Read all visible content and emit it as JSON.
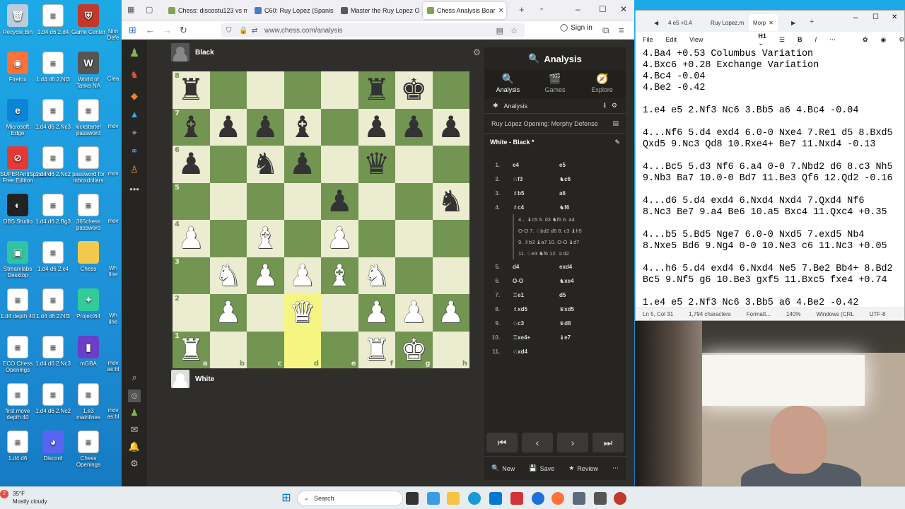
{
  "desktop": {
    "icons": [
      {
        "label": "Recycle Bin",
        "glyph": "🗑",
        "color": "#bcd"
      },
      {
        "label": "1.d4 d6 2.d4",
        "glyph": "≡",
        "color": "#fff"
      },
      {
        "label": "Game Center",
        "glyph": "⛨",
        "color": "#c0392b"
      },
      {
        "label": "Firefox",
        "glyph": "◉",
        "color": "#ff7139"
      },
      {
        "label": "1.d4 d6 2.Nf3",
        "glyph": "≡",
        "color": "#fff"
      },
      {
        "label": "World of Tanks NA",
        "glyph": "W",
        "color": "#555"
      },
      {
        "label": "Microsoft Edge",
        "glyph": "e",
        "color": "#0b84d8"
      },
      {
        "label": "1.d4 d6 2.Nc3",
        "glyph": "≡",
        "color": "#fff"
      },
      {
        "label": "kickstarter password",
        "glyph": "≡",
        "color": "#fff"
      },
      {
        "label": "SUPERAntiSpyware Free Edition",
        "glyph": "⊘",
        "color": "#e53935"
      },
      {
        "label": "1.d4 d6 2.Nc2",
        "glyph": "≡",
        "color": "#fff"
      },
      {
        "label": "password for inboxdollars",
        "glyph": "≡",
        "color": "#fff"
      },
      {
        "label": "OBS Studio",
        "glyph": "◐",
        "color": "#222"
      },
      {
        "label": "1.d4 d6 2.Bg3",
        "glyph": "≡",
        "color": "#fff"
      },
      {
        "label": "365chess password",
        "glyph": "≡",
        "color": "#fff"
      },
      {
        "label": "Streamlabs Desktop",
        "glyph": "▣",
        "color": "#31c3a2"
      },
      {
        "label": "1.d4 d6 2.c4",
        "glyph": "≡",
        "color": "#fff"
      },
      {
        "label": "Chess",
        "glyph": "",
        "color": "#f2c94c"
      },
      {
        "label": "1.d4 depth 40",
        "glyph": "≡",
        "color": "#fff"
      },
      {
        "label": "1.d4 d6 2.Nf3",
        "glyph": "≡",
        "color": "#fff"
      },
      {
        "label": "Project64",
        "glyph": "✦",
        "color": "#3c9"
      },
      {
        "label": "ECO Chess Openings",
        "glyph": "≡",
        "color": "#fff"
      },
      {
        "label": "1.d4 d6 2.Nc3",
        "glyph": "≡",
        "color": "#fff"
      },
      {
        "label": "mGBA",
        "glyph": "▮",
        "color": "#6a3ec9"
      },
      {
        "label": "first move depth 40",
        "glyph": "≡",
        "color": "#fff"
      },
      {
        "label": "1.d4 d6 2.Nc2",
        "glyph": "≡",
        "color": "#fff"
      },
      {
        "label": "1.e3 mainlines",
        "glyph": "≡",
        "color": "#fff"
      },
      {
        "label": "1.d4 d6",
        "glyph": "≡",
        "color": "#fff"
      },
      {
        "label": "Discord",
        "glyph": "◕",
        "color": "#5865f2"
      },
      {
        "label": "Chess Openings",
        "glyph": "≡",
        "color": "#fff"
      }
    ],
    "partial_col3": [
      "Nim Defe",
      "Clea",
      "mov",
      "mov",
      "mov",
      "Wh line",
      "Wh line",
      "mov as bl",
      "mov as bl"
    ]
  },
  "browser": {
    "tabs": [
      {
        "title": "Chess: discostu123 vs m",
        "color": "#7fa650"
      },
      {
        "title": "C60: Ruy Lopez (Spanish",
        "color": "#4a7bd0"
      },
      {
        "title": "Master the Ruy Lopez O",
        "color": "#5a5a5a"
      },
      {
        "title": "Chess Analysis Boar",
        "color": "#7fa650",
        "active": true
      }
    ],
    "url": "www.chess.com/analysis",
    "sign_in": "Sign in"
  },
  "chess": {
    "top_player": "Black",
    "bottom_player": "White",
    "board": [
      [
        "bR",
        "",
        "",
        "",
        "",
        "bR",
        "bK",
        ""
      ],
      [
        "bB",
        "bP",
        "bP",
        "bB",
        "",
        "bP",
        "bP",
        "bP"
      ],
      [
        "bP",
        "",
        "bN",
        "bP",
        "",
        "bQ",
        "",
        ""
      ],
      [
        "",
        "",
        "",
        "",
        "bP",
        "",
        "",
        "bN"
      ],
      [
        "wP",
        "",
        "wB",
        "",
        "wP",
        "",
        "",
        ""
      ],
      [
        "",
        "wN",
        "wP",
        "wP",
        "wB",
        "wN",
        "",
        ""
      ],
      [
        "",
        "wP",
        "",
        "wQ",
        "",
        "wP",
        "wP",
        "wP"
      ],
      [
        "wR",
        "",
        "",
        "",
        "",
        "wR",
        "wK",
        ""
      ]
    ],
    "highlight": [
      [
        6,
        3
      ],
      [
        7,
        3
      ]
    ],
    "ranks": [
      "8",
      "7",
      "6",
      "5",
      "4",
      "3",
      "2",
      "1"
    ],
    "files": [
      "a",
      "b",
      "c",
      "d",
      "e",
      "f",
      "g",
      "h"
    ],
    "panel_title": "Analysis",
    "panel_tabs": [
      "Analysis",
      "Games",
      "Explore"
    ],
    "engine_label": "Analysis",
    "opening": "Ruy López Opening: Morphy Defense",
    "players_line": "White - Black *",
    "moves": [
      {
        "n": "1.",
        "w": "e4",
        "b": "e5"
      },
      {
        "n": "2.",
        "w": "♘f3",
        "b": "♞c6"
      },
      {
        "n": "3.",
        "w": "♗b5",
        "b": "a6"
      },
      {
        "n": "4.",
        "w": "♗c4",
        "b": "♞f6"
      }
    ],
    "variation_lines": [
      "4... ♝c5  5. d3  ♞f6  6. a4",
      "O-O  7. ♘bd2  d6  8. c3  ♝h5",
      "9. ♗b3  ♝a7  10. O-O  ♝d7",
      "11. ♘e3  ♞f6  12. ♕d2"
    ],
    "moves2": [
      {
        "n": "5.",
        "w": "d4",
        "b": "exd4"
      },
      {
        "n": "6.",
        "w": "O-O",
        "b": "♞xe4"
      },
      {
        "n": "7.",
        "w": "♖e1",
        "b": "d5"
      },
      {
        "n": "8.",
        "w": "♗xd5",
        "b": "♛xd5"
      },
      {
        "n": "9.",
        "w": "♘c3",
        "b": "♛d8"
      },
      {
        "n": "10.",
        "w": "♖xe4+",
        "b": "♝e7"
      },
      {
        "n": "11.",
        "w": "♘xd4",
        "b": ""
      }
    ],
    "nav": [
      "⏮",
      "‹",
      "›",
      "⏭"
    ],
    "footer": [
      "New",
      "Save",
      "Review"
    ]
  },
  "notepad": {
    "tabs": [
      {
        "title": "4 e5 +0.4"
      },
      {
        "title": "Ruy Lopez.m"
      },
      {
        "title": "Morp",
        "active": true
      }
    ],
    "menu": [
      "File",
      "Edit",
      "View"
    ],
    "lines": [
      "4.Ba4 +0.53 Columbus Variation",
      "4.Bxc6 +0.28 Exchange Variation",
      "4.Bc4 -0.04",
      "4.Be2 -0.42",
      "",
      "1.e4 e5 2.Nf3 Nc6 3.Bb5 a6 4.Bc4 -0.04",
      "",
      "4...Nf6 5.d4 exd4 6.0-0 Nxe4 7.Re1 d5 8.Bxd5",
      "Qxd5 9.Nc3 Qd8 10.Rxe4+ Be7 11.Nxd4 -0.13",
      "",
      "4...Bc5 5.d3 Nf6 6.a4 0-0 7.Nbd2 d6 8.c3 Nh5",
      "9.Nb3 Ba7 10.0-0 Bd7 11.Be3 Qf6 12.Qd2 -0.16",
      "",
      "4...d6 5.d4 exd4 6.Nxd4 Nxd4 7.Qxd4 Nf6",
      "8.Nc3 Be7 9.a4 Be6 10.a5 Bxc4 11.Qxc4 +0.35",
      "",
      "4...b5 5.Bd5 Nge7 6.0-0 Nxd5 7.exd5 Nb4",
      "8.Nxe5 Bd6 9.Ng4 0-0 10.Ne3 c6 11.Nc3 +0.05",
      "",
      "4...h6 5.d4 exd4 6.Nxd4 Ne5 7.Be2 Bb4+ 8.Bd2",
      "Bc5 9.Nf5 g6 10.Be3 gxf5 11.Bxc5 fxe4 +0.74",
      "",
      "1.e4 e5 2.Nf3 Nc6 3.Bb5 a6 4.Be2 -0.42"
    ],
    "status": [
      "Ln 5, Col 31",
      "1,794 characters",
      "Formatt...",
      "140%",
      "Windows (CRL",
      "UTF-8"
    ]
  },
  "taskbar": {
    "weather_temp": "35°F",
    "weather_desc": "Mostly cloudy",
    "weather_badge": "2",
    "search": "Search"
  }
}
